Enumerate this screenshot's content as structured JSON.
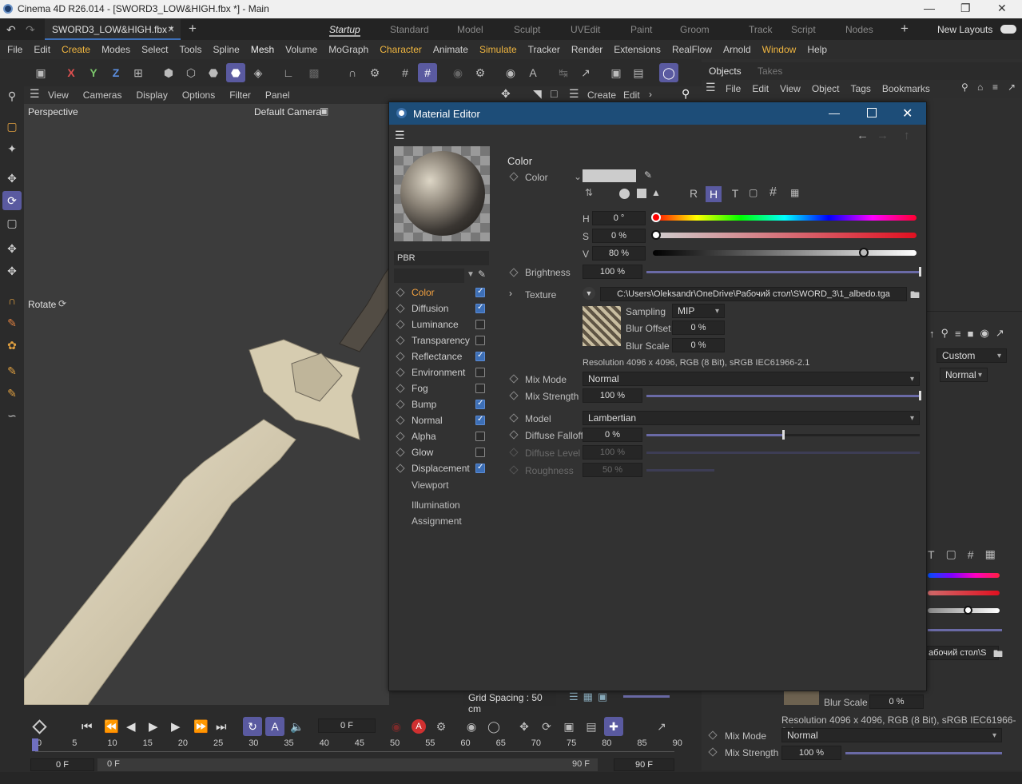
{
  "window": {
    "title": "Cinema 4D R26.014 - [SWORD3_LOW&HIGH.fbx *] - Main",
    "minimize": "—",
    "maximize": "❐",
    "close": "✕"
  },
  "tabs": {
    "file": "SWORD3_LOW&HIGH.fbx *",
    "close": "×",
    "add": "+",
    "layouts": [
      "Startup",
      "Standard",
      "Model",
      "Sculpt",
      "UVEdit",
      "Paint",
      "Groom",
      "Track",
      "Script",
      "Nodes"
    ],
    "new_layouts": "New Layouts"
  },
  "menu": [
    "File",
    "Edit",
    "Create",
    "Modes",
    "Select",
    "Tools",
    "Spline",
    "Mesh",
    "Volume",
    "MoGraph",
    "Character",
    "Animate",
    "Simulate",
    "Tracker",
    "Render",
    "Extensions",
    "RealFlow",
    "Arnold",
    "Window",
    "Help"
  ],
  "axes": {
    "x": "X",
    "y": "Y",
    "z": "Z"
  },
  "viewport": {
    "menu": [
      "View",
      "Cameras",
      "Display",
      "Options",
      "Filter",
      "Panel"
    ],
    "name": "Perspective",
    "camera": "Default Camera",
    "mode": "Rotate",
    "grid": "Grid Spacing : 50 cm",
    "create": "Create",
    "edit": "Edit"
  },
  "objects": {
    "tabs": [
      "Objects",
      "Takes"
    ],
    "menu": [
      "File",
      "Edit",
      "View",
      "Object",
      "Tags",
      "Bookmarks"
    ],
    "custom": "Custom",
    "normal": "Normal",
    "path_frag": "абочий стол\\S",
    "blur_scale": "Blur Scale",
    "blur_scale_val": "0 %",
    "resolution": "Resolution 4096 x 4096, RGB (8 Bit), sRGB IEC61966-2.1",
    "mix_mode": "Mix Mode",
    "mix_mode_val": "Normal",
    "mix_strength": "Mix Strength",
    "mix_strength_val": "100 %"
  },
  "material_editor": {
    "title": "Material Editor",
    "name": "PBR",
    "channels": [
      {
        "label": "Color",
        "checked": true,
        "active": true
      },
      {
        "label": "Diffusion",
        "checked": true
      },
      {
        "label": "Luminance",
        "checked": false
      },
      {
        "label": "Transparency",
        "checked": false
      },
      {
        "label": "Reflectance",
        "checked": true
      },
      {
        "label": "Environment",
        "checked": false
      },
      {
        "label": "Fog",
        "checked": false
      },
      {
        "label": "Bump",
        "checked": true
      },
      {
        "label": "Normal",
        "checked": true
      },
      {
        "label": "Alpha",
        "checked": false
      },
      {
        "label": "Glow",
        "checked": false
      },
      {
        "label": "Displacement",
        "checked": true
      }
    ],
    "extra": [
      "Viewport",
      "Illumination",
      "Assignment"
    ],
    "section": "Color",
    "color_label": "Color",
    "modes": [
      "R",
      "H",
      "T"
    ],
    "h_label": "H",
    "h_val": "0 °",
    "s_label": "S",
    "s_val": "0 %",
    "v_label": "V",
    "v_val": "80 %",
    "v_level": 0.8,
    "brightness": "Brightness",
    "brightness_val": "100 %",
    "texture": "Texture",
    "texture_path": "C:\\Users\\Oleksandr\\OneDrive\\Рабочий стол\\SWORD_3\\1_albedo.tga",
    "sampling": "Sampling",
    "sampling_val": "MIP",
    "blur_offset": "Blur Offset",
    "blur_offset_val": "0 %",
    "blur_scale": "Blur Scale",
    "blur_scale_val": "0 %",
    "resolution": "Resolution 4096 x 4096, RGB (8 Bit), sRGB IEC61966-2.1",
    "mix_mode": "Mix Mode",
    "mix_mode_val": "Normal",
    "mix_strength": "Mix Strength",
    "mix_strength_val": "100 %",
    "model": "Model",
    "model_val": "Lambertian",
    "diffuse_falloff": "Diffuse Falloff",
    "diffuse_falloff_val": "0 %",
    "diffuse_level": "Diffuse Level",
    "diffuse_level_val": "100 %",
    "roughness": "Roughness",
    "roughness_val": "50 %"
  },
  "timeline": {
    "frame": "0 F",
    "ticks": [
      "0",
      "5",
      "10",
      "15",
      "20",
      "25",
      "30",
      "35",
      "40",
      "45",
      "50",
      "55",
      "60",
      "65",
      "70",
      "75",
      "80",
      "85",
      "90"
    ],
    "start": "0 F",
    "start2": "0 F",
    "end": "90 F",
    "end2": "90 F"
  }
}
